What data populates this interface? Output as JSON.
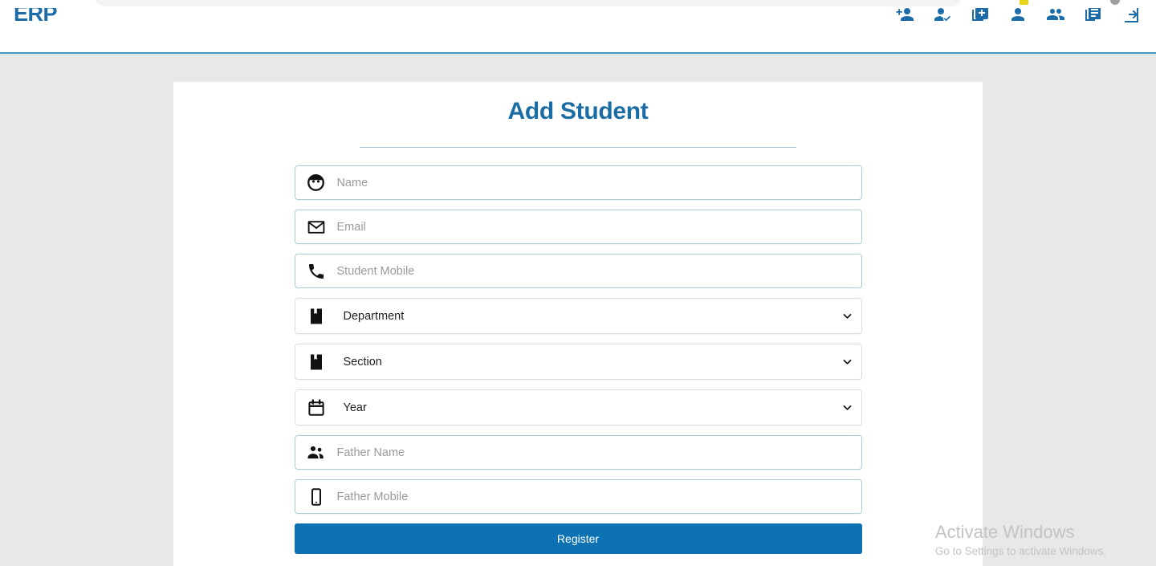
{
  "browser": {
    "omnibox_visible": true,
    "extension_badge_color": "#e8d316",
    "avatar_color": "#9e9e9e"
  },
  "navbar": {
    "brand": "ERP",
    "brand_color": "#1b6ca8",
    "border_color": "#3e9bb5",
    "icons": [
      {
        "name": "person-add-icon",
        "title": "Add Person"
      },
      {
        "name": "person-check-icon",
        "title": "Verify Person"
      },
      {
        "name": "library-add-icon",
        "title": "Add Item"
      },
      {
        "name": "person-icon",
        "title": "Profile"
      },
      {
        "name": "people-group-icon",
        "title": "Groups"
      },
      {
        "name": "article-icon",
        "title": "Records"
      },
      {
        "name": "logout-icon",
        "title": "Logout"
      }
    ]
  },
  "page": {
    "background_color": "#e8e8e8",
    "card_background": "#ffffff"
  },
  "form": {
    "title": "Add Student",
    "title_color": "#1a6ca5",
    "fields": [
      {
        "id": "name",
        "type": "text",
        "icon": "account-face-icon",
        "placeholder": "Name",
        "value": ""
      },
      {
        "id": "email",
        "type": "text",
        "icon": "envelope-icon",
        "placeholder": "Email",
        "value": ""
      },
      {
        "id": "student_mobile",
        "type": "text",
        "icon": "phone-icon",
        "placeholder": "Student Mobile",
        "value": ""
      },
      {
        "id": "department",
        "type": "select",
        "icon": "book-icon",
        "placeholder": "Department",
        "value": "Department"
      },
      {
        "id": "section",
        "type": "select",
        "icon": "book-icon",
        "placeholder": "Section",
        "value": "Section"
      },
      {
        "id": "year",
        "type": "select",
        "icon": "calendar-icon",
        "placeholder": "Year",
        "value": "Year"
      },
      {
        "id": "father_name",
        "type": "text",
        "icon": "people-group-icon",
        "placeholder": "Father Name",
        "value": ""
      },
      {
        "id": "father_mobile",
        "type": "text",
        "icon": "smartphone-icon",
        "placeholder": "Father Mobile",
        "value": ""
      }
    ],
    "submit_label": "Register",
    "submit_color": "#0c72b3"
  },
  "watermark": {
    "title": "Activate Windows",
    "subtitle": "Go to Settings to activate Windows."
  }
}
